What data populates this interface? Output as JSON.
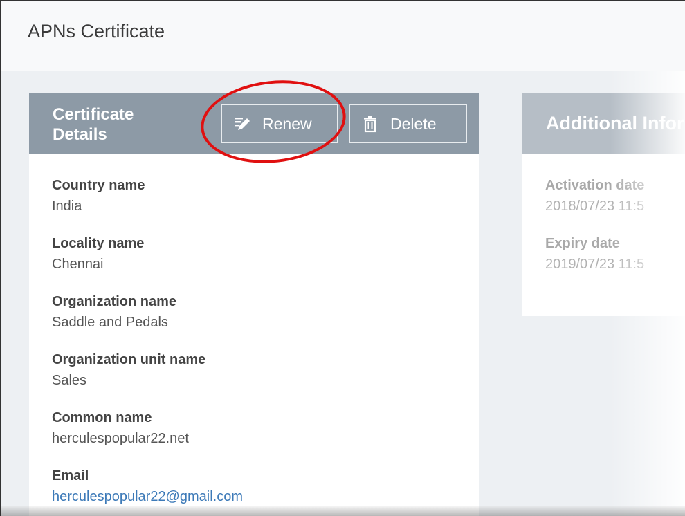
{
  "page": {
    "title": "APNs Certificate"
  },
  "certificate_card": {
    "title": "Certificate Details",
    "renew_label": "Renew",
    "delete_label": "Delete",
    "fields": [
      {
        "label": "Country name",
        "value": "India"
      },
      {
        "label": "Locality name",
        "value": "Chennai"
      },
      {
        "label": "Organization name",
        "value": "Saddle and Pedals"
      },
      {
        "label": "Organization unit name",
        "value": "Sales"
      },
      {
        "label": "Common name",
        "value": "herculespopular22.net"
      },
      {
        "label": "Email",
        "value": "herculespopular22@gmail.com"
      }
    ]
  },
  "additional_card": {
    "title": "Additional Information",
    "fields": [
      {
        "label": "Activation date",
        "value": "2018/07/23 11:5"
      },
      {
        "label": "Expiry date",
        "value": "2019/07/23 11:5"
      }
    ]
  },
  "icons": {
    "renew": "pencil-icon",
    "delete": "trash-icon"
  },
  "colors": {
    "header": "#8d9aa6",
    "highlight": "#e01010",
    "link": "#3d7ab8"
  }
}
